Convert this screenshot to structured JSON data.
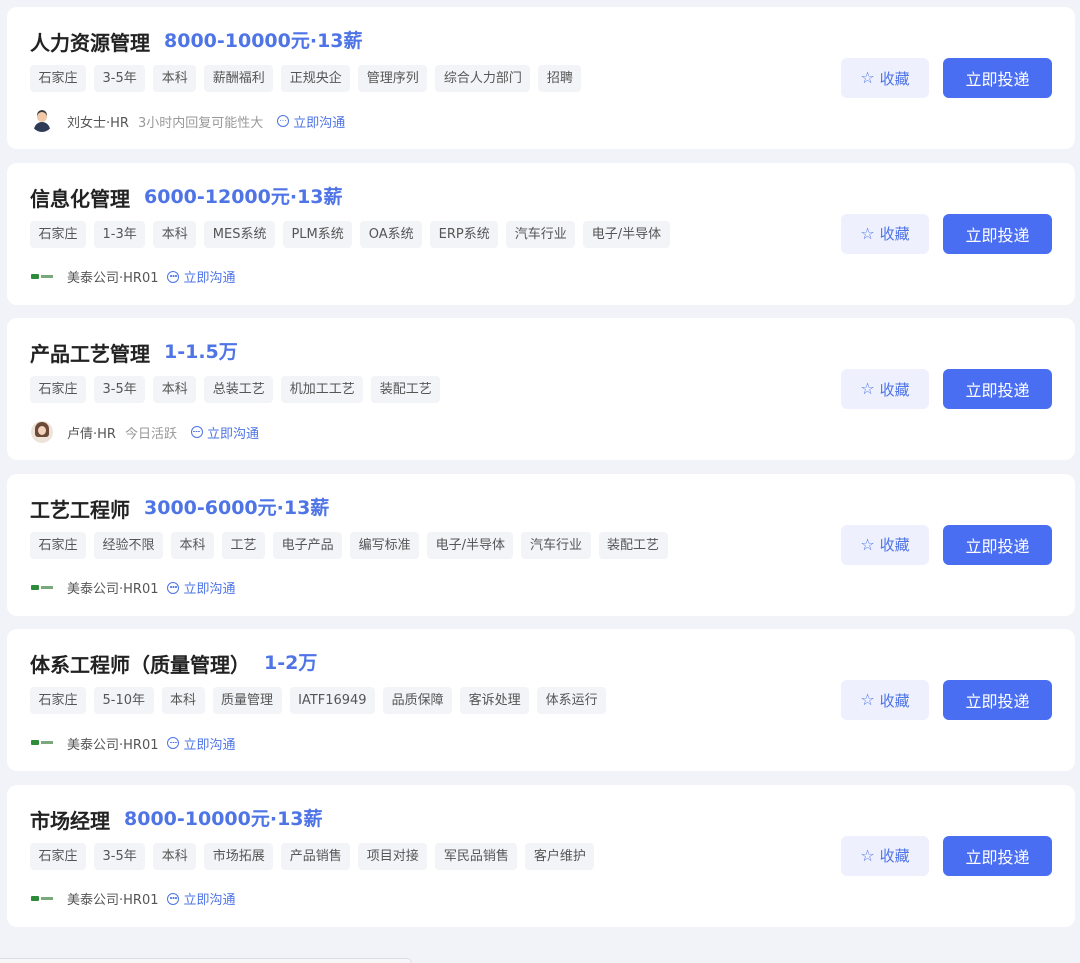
{
  "actions": {
    "favorite_label": "收藏",
    "apply_label": "立即投递",
    "chat_label": "立即沟通"
  },
  "jobs": [
    {
      "title": "人力资源管理",
      "salary": "8000-10000元·13薪",
      "tags": [
        "石家庄",
        "3-5年",
        "本科",
        "薪酬福利",
        "正规央企",
        "管理序列",
        "综合人力部门",
        "招聘"
      ],
      "hr_name": "刘女士·HR",
      "hr_status": "3小时内回复可能性大",
      "avatar": "male-avatar"
    },
    {
      "title": "信息化管理",
      "salary": "6000-12000元·13薪",
      "tags": [
        "石家庄",
        "1-3年",
        "本科",
        "MES系统",
        "PLM系统",
        "OA系统",
        "ERP系统",
        "汽车行业",
        "电子/半导体"
      ],
      "hr_name": "美泰公司·HR01",
      "hr_status": "",
      "avatar": "company-logo"
    },
    {
      "title": "产品工艺管理",
      "salary": "1-1.5万",
      "tags": [
        "石家庄",
        "3-5年",
        "本科",
        "总装工艺",
        "机加工工艺",
        "装配工艺"
      ],
      "hr_name": "卢倩·HR",
      "hr_status": "今日活跃",
      "avatar": "female-avatar"
    },
    {
      "title": "工艺工程师",
      "salary": "3000-6000元·13薪",
      "tags": [
        "石家庄",
        "经验不限",
        "本科",
        "工艺",
        "电子产品",
        "编写标准",
        "电子/半导体",
        "汽车行业",
        "装配工艺"
      ],
      "hr_name": "美泰公司·HR01",
      "hr_status": "",
      "avatar": "company-logo"
    },
    {
      "title": "体系工程师（质量管理）",
      "salary": "1-2万",
      "tags": [
        "石家庄",
        "5-10年",
        "本科",
        "质量管理",
        "IATF16949",
        "品质保障",
        "客诉处理",
        "体系运行"
      ],
      "hr_name": "美泰公司·HR01",
      "hr_status": "",
      "avatar": "company-logo"
    },
    {
      "title": "市场经理",
      "salary": "8000-10000元·13薪",
      "tags": [
        "石家庄",
        "3-5年",
        "本科",
        "市场拓展",
        "产品销售",
        "项目对接",
        "军民品销售",
        "客户维护"
      ],
      "hr_name": "美泰公司·HR01",
      "hr_status": "",
      "avatar": "company-logo"
    }
  ]
}
